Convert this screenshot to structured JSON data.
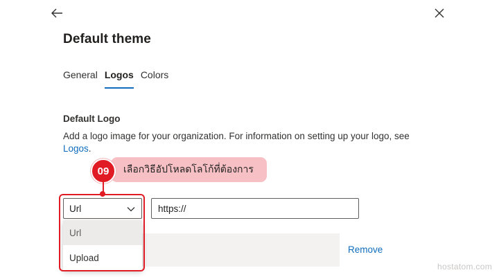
{
  "header": {
    "back_icon": "arrow-left-icon",
    "close_icon": "close-icon",
    "title": "Default theme"
  },
  "tabs": [
    {
      "label": "General",
      "active": false
    },
    {
      "label": "Logos",
      "active": true
    },
    {
      "label": "Colors",
      "active": false
    }
  ],
  "section": {
    "title": "Default Logo",
    "description": "Add a logo image for your organization. For information on setting up your logo, see",
    "link_text": "Logos",
    "link_suffix": "."
  },
  "annotation": {
    "step_number": "09",
    "text": "เลือกวิธีอัปโหลดโลโก้ที่ต้องการ",
    "color": "#e01b24",
    "bubble_color": "#f7c0c4"
  },
  "logo_source": {
    "selected": "Url",
    "options": [
      "Url",
      "Upload"
    ],
    "chevron_icon": "chevron-down-icon"
  },
  "url_field": {
    "value": "https://"
  },
  "actions": {
    "remove_label": "Remove"
  },
  "watermark": "hostatom.com",
  "colors": {
    "accent": "#0f6cbd",
    "highlight": "#e01b24"
  }
}
